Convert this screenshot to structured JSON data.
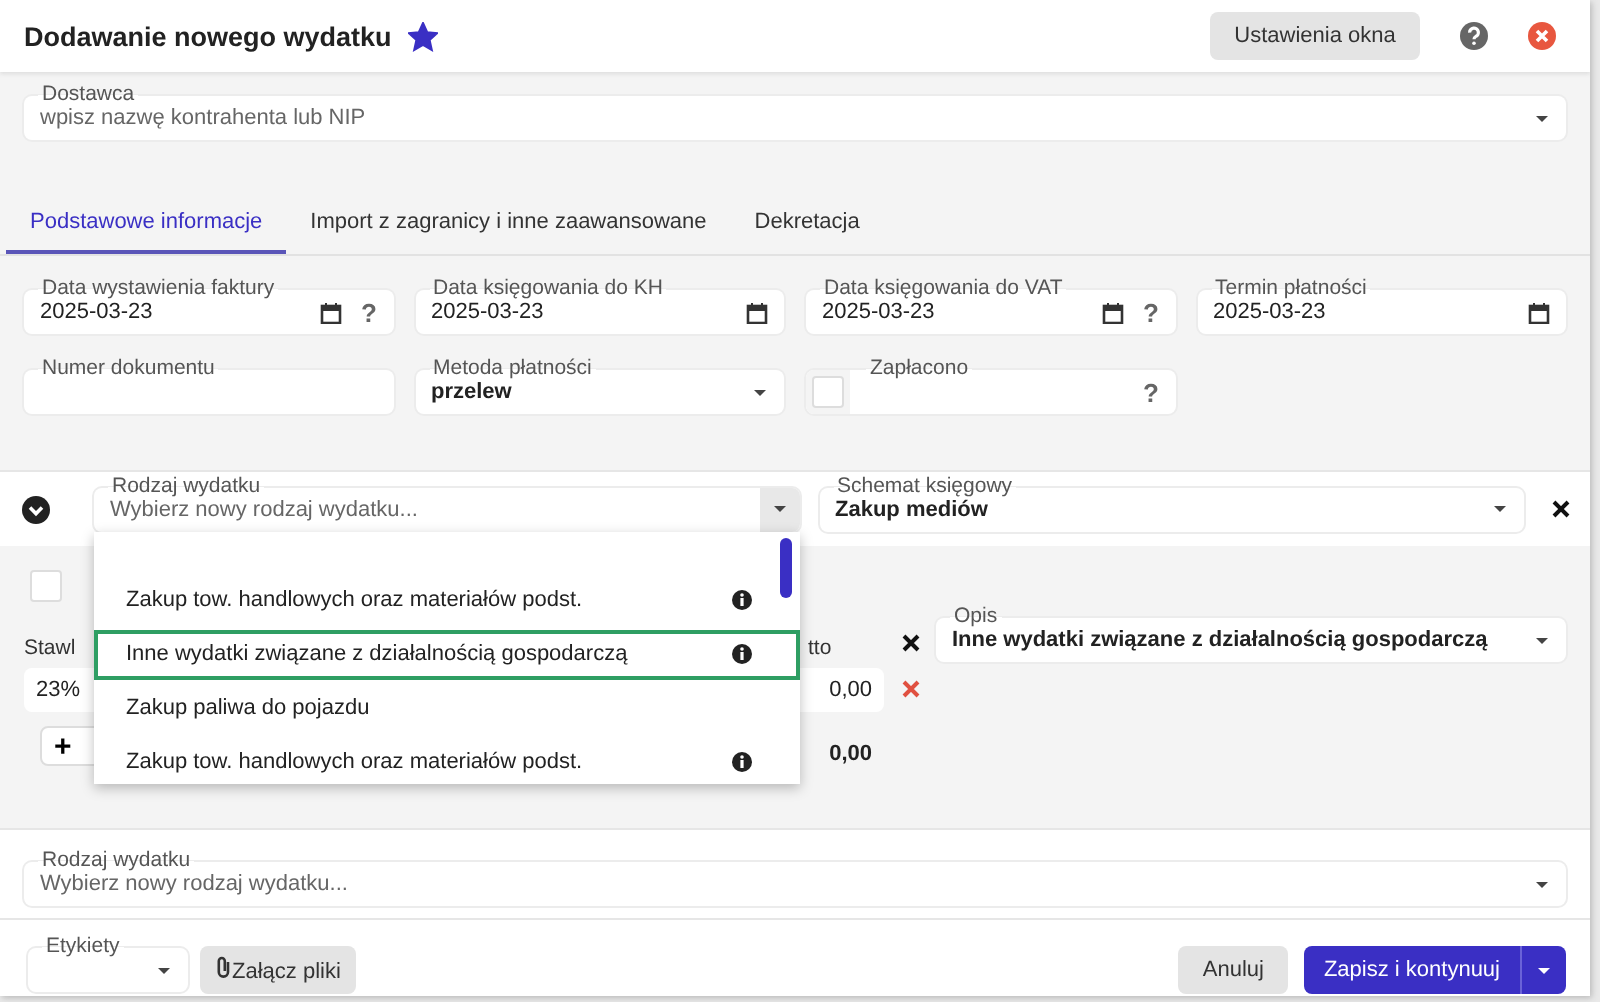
{
  "window": {
    "title": "Dodawanie nowego wydatku",
    "favorite": true
  },
  "settings_button": "Ustawienia okna",
  "supplier": {
    "label": "Dostawca",
    "placeholder": "wpisz nazwę kontrahenta lub NIP"
  },
  "tabs": [
    {
      "label": "Podstawowe informacje",
      "selected": true
    },
    {
      "label": "Import z zagranicy i inne zaawansowane",
      "selected": false
    },
    {
      "label": "Dekretacja",
      "selected": false
    }
  ],
  "fields": [
    {
      "kind": "date",
      "label": "Data wystawienia faktury",
      "value": "2025-03-23",
      "help": "?"
    },
    {
      "kind": "date",
      "label": "Data księgowania do KH",
      "value": "2025-03-23"
    },
    {
      "kind": "date",
      "label": "Data księgowania do VAT",
      "value": "2025-03-23",
      "help": "?"
    },
    {
      "kind": "date",
      "label": "Termin płatności",
      "value": "2025-03-23"
    },
    {
      "kind": "text",
      "label": "Numer dokumentu"
    },
    {
      "kind": "select",
      "label": "Metoda płatności",
      "value": "przelew"
    },
    {
      "kind": "checkbox",
      "label": "Zapłacono",
      "checked": false,
      "help": "?"
    }
  ],
  "expense_type": {
    "label": "Rodzaj wydatku",
    "placeholder": "Wybierz nowy rodzaj wydatku...",
    "expanded": true,
    "options": [
      {
        "label": "Zakup tow. handlowych oraz materiałów podst.",
        "info": true,
        "selected": false
      },
      {
        "label": "Inne wydatki związane z działalnością gospodarczą",
        "info": true,
        "selected": true
      },
      {
        "label": "Zakup paliwa do pojazdu",
        "info": false,
        "selected": false
      },
      {
        "label": "Zakup tow. handlowych oraz materiałów podst.",
        "info": true,
        "selected": false
      }
    ]
  },
  "scheme": {
    "label": "Schemat księgowy",
    "value": "Zakup mediów"
  },
  "vat": {
    "checked": false,
    "rate_label": "Stawl",
    "rate": "23%",
    "net_label": "tto",
    "net": "0,00",
    "add": "+",
    "total": "0,00"
  },
  "description": {
    "label": "Opis",
    "value": "Inne wydatki związane z działalnością gospodarczą"
  },
  "expense_type_2": {
    "label": "Rodzaj wydatku",
    "placeholder": "Wybierz nowy rodzaj wydatku..."
  },
  "footer": {
    "tags_label": "Etykiety",
    "attach": "Załącz pliki",
    "cancel": "Anuluj",
    "save": "Zapisz i kontynuuj"
  }
}
